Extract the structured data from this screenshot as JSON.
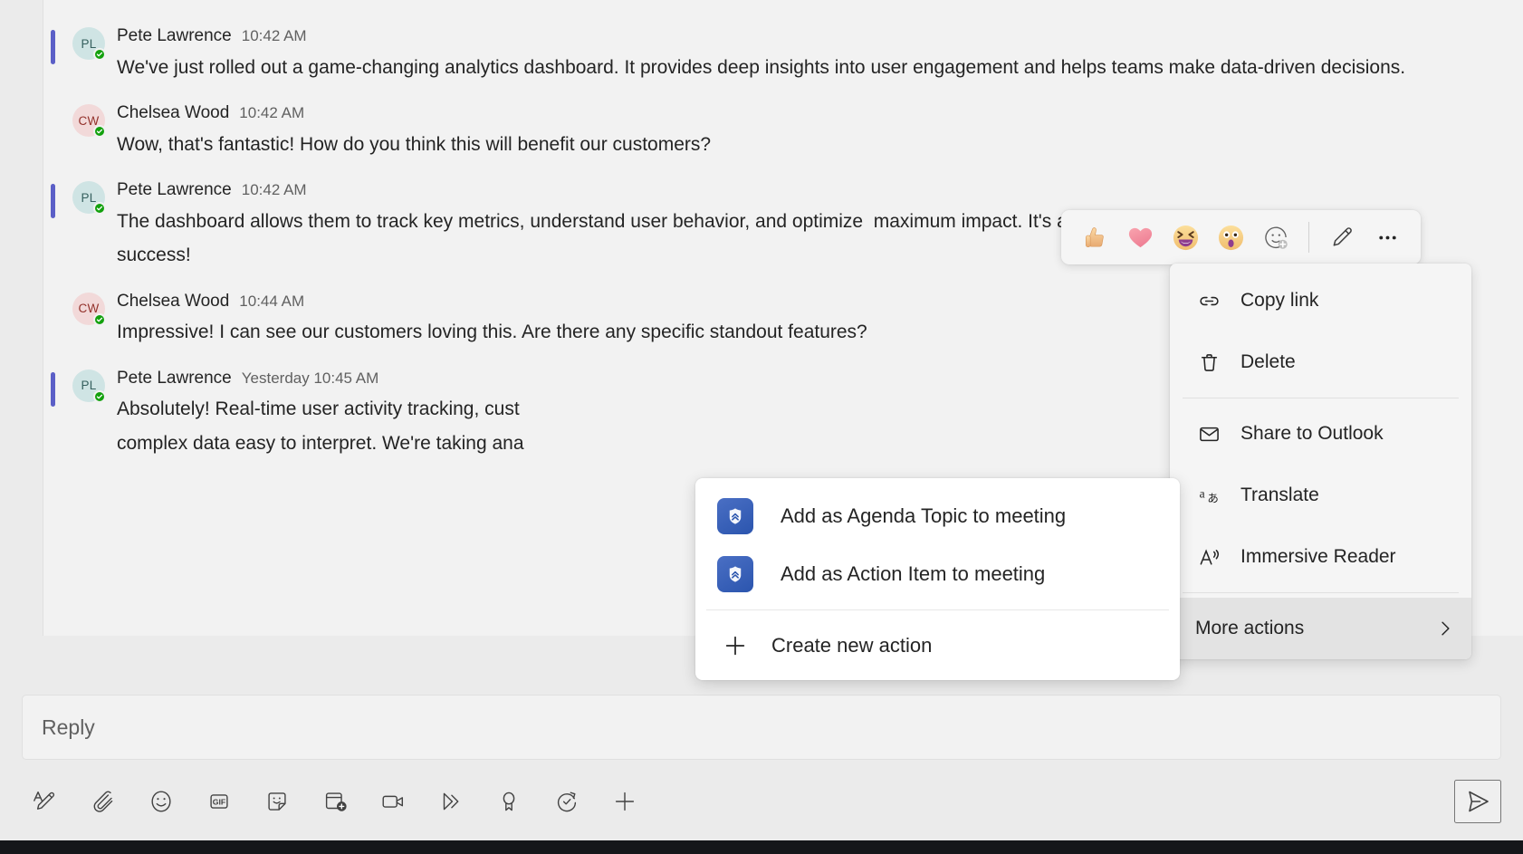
{
  "thread": {
    "messages": [
      {
        "author": "Pete Lawrence",
        "initials": "PL",
        "timestamp": "10:42 AM",
        "text": "We've just rolled out a game-changing analytics dashboard. It provides deep insights into user engagement and helps teams make data-driven decisions.",
        "avatar_bg": "#cfe4e4",
        "avatar_fg": "#35605e",
        "unread": true,
        "presence": "available"
      },
      {
        "author": "Chelsea Wood",
        "initials": "CW",
        "timestamp": "10:42 AM",
        "text": "Wow, that's fantastic! How do you think this will benefit our customers?",
        "avatar_bg": "#f2d9d9",
        "avatar_fg": "#93312b",
        "unread": false,
        "presence": "available"
      },
      {
        "author": "Pete Lawrence",
        "initials": "PL",
        "timestamp": "10:42 AM",
        "text": "The dashboard allows them to track key metrics, understand user behavior, and optimize  maximum impact. It's a game-changer for driving success!",
        "avatar_bg": "#cfe4e4",
        "avatar_fg": "#35605e",
        "unread": true,
        "presence": "available"
      },
      {
        "author": "Chelsea Wood",
        "initials": "CW",
        "timestamp": "10:44 AM",
        "text": "Impressive! I can see our customers loving this. Are there any specific standout features?",
        "avatar_bg": "#f2d9d9",
        "avatar_fg": "#93312b",
        "unread": false,
        "presence": "available"
      },
      {
        "author": "Pete Lawrence",
        "initials": "PL",
        "timestamp": "Yesterday 10:45 AM",
        "text": "Absolutely! Real-time user activity tracking, cust                                      complex data easy to interpret. We're taking ana",
        "avatar_bg": "#cfe4e4",
        "avatar_fg": "#35605e",
        "unread": true,
        "presence": "available"
      }
    ]
  },
  "reaction_bar": {
    "reactions": [
      {
        "name": "thumbs-up-reaction",
        "emoji": "👍"
      },
      {
        "name": "heart-reaction",
        "emoji": "❤️"
      },
      {
        "name": "laugh-reaction",
        "emoji": "😆"
      },
      {
        "name": "surprised-reaction",
        "emoji": "😮"
      }
    ],
    "more_reactions_label": "more-reactions",
    "edit_label": "edit",
    "more_options_label": "more-options"
  },
  "context_menu": {
    "items": [
      {
        "label": "Copy link",
        "icon": "link-icon",
        "name": "copy-link"
      },
      {
        "label": "Delete",
        "icon": "trash-icon",
        "name": "delete"
      },
      {
        "label": "Share to Outlook",
        "icon": "mail-icon",
        "name": "share-to-outlook"
      },
      {
        "label": "Translate",
        "icon": "translate-icon",
        "name": "translate"
      },
      {
        "label": "Immersive Reader",
        "icon": "immersive-reader-icon",
        "name": "immersive-reader"
      },
      {
        "label": "More actions",
        "icon": "none",
        "name": "more-actions",
        "has_submenu": true,
        "hovered": true
      }
    ]
  },
  "submenu": {
    "items": [
      {
        "label": "Add as Agenda Topic to meeting",
        "icon": "app-chevron-badge-icon",
        "name": "add-agenda-topic"
      },
      {
        "label": "Add as Action Item to meeting",
        "icon": "app-chevron-badge-icon",
        "name": "add-action-item"
      }
    ],
    "create_label": "Create new action"
  },
  "compose": {
    "placeholder": "Reply",
    "toolbar": [
      {
        "name": "format-icon",
        "label": "Format"
      },
      {
        "name": "attach-icon",
        "label": "Attach"
      },
      {
        "name": "emoji-icon",
        "label": "Emoji"
      },
      {
        "name": "gif-icon",
        "label": "GIF"
      },
      {
        "name": "sticker-icon",
        "label": "Sticker"
      },
      {
        "name": "praise-card-icon",
        "label": "Card"
      },
      {
        "name": "video-icon",
        "label": "Video clip"
      },
      {
        "name": "stream-icon",
        "label": "Stream"
      },
      {
        "name": "praise-icon",
        "label": "Praise"
      },
      {
        "name": "loop-icon",
        "label": "Loop"
      },
      {
        "name": "more-apps-icon",
        "label": "More apps"
      }
    ],
    "send_label": "Send"
  },
  "colors": {
    "unread_bar": "#5b5fc7",
    "presence_green": "#13a10e",
    "app_blue": "#2b55ae",
    "panel_bg": "#f2f2f2",
    "page_bg": "#ebebeb"
  }
}
